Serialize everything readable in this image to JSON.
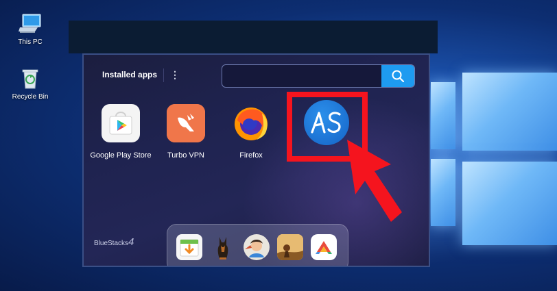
{
  "desktop": {
    "icons": [
      {
        "label": "This PC",
        "icon": "computer-icon"
      },
      {
        "label": "Recycle Bin",
        "icon": "recycle-bin-icon"
      }
    ]
  },
  "bluestacks": {
    "section_title": "Installed apps",
    "menu_glyph": "⋮",
    "search": {
      "placeholder": "",
      "value": ""
    },
    "apps": [
      {
        "label": "Google Play Store",
        "icon": "google-play-icon"
      },
      {
        "label": "Turbo VPN",
        "icon": "turbo-vpn-icon"
      },
      {
        "label": "Firefox",
        "icon": "firefox-icon"
      },
      {
        "label": "",
        "icon": "apk-installer-as-icon",
        "highlighted": true
      }
    ],
    "brand": {
      "name": "BlueStacks",
      "version": "4"
    },
    "dock": [
      {
        "icon": "app-center-icon"
      },
      {
        "icon": "doberman-game-icon"
      },
      {
        "icon": "cartoon-avatar-icon"
      },
      {
        "icon": "adventure-game-icon"
      },
      {
        "icon": "arrow-launcher-icon"
      }
    ]
  },
  "colors": {
    "highlight": "#f5141e",
    "search_button": "#1e9bf0",
    "window_bg": "#1f2350"
  }
}
